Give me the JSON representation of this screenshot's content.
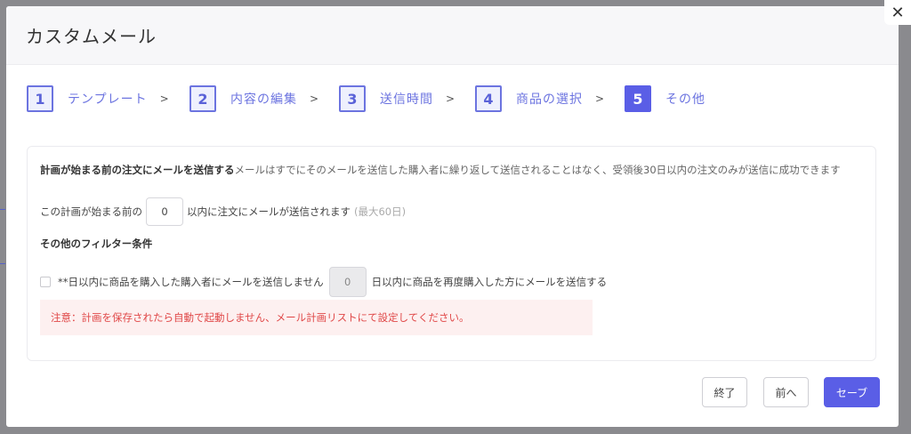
{
  "modal": {
    "title": "カスタムメール",
    "close_symbol": "✕"
  },
  "steps": [
    {
      "num": "1",
      "label": "テンプレート",
      "sep": ">",
      "active": false
    },
    {
      "num": "2",
      "label": "内容の編集",
      "sep": ">",
      "active": false
    },
    {
      "num": "3",
      "label": "送信時間",
      "sep": ">",
      "active": false
    },
    {
      "num": "4",
      "label": "商品の選択",
      "sep": ">",
      "active": false
    },
    {
      "num": "5",
      "label": "その他",
      "sep": "",
      "active": true
    }
  ],
  "panel": {
    "intro_bold": "計画が始まる前の注文にメールを送信する",
    "intro_text": "メールはすでにそのメールを送信した購入者に繰り返して送信されることはなく、受領後30日以内の注文のみが送信に成功できます",
    "row1_prefix": "この計画が始まる前の",
    "row1_value": "0",
    "row1_suffix": "以内に注文にメールが送信されます",
    "row1_hint": "(最大60日)",
    "filter_title": "その他のフィルター条件",
    "row2_prefix": "**日以内に商品を購入した購入者にメールを送信しません",
    "row2_value": "0",
    "row2_suffix": "日以内に商品を再度購入した方にメールを送信する",
    "row2_checked": false,
    "alert": "注意：計画を保存されたら自動で起動しません、メール計画リストにて設定してください。"
  },
  "footer": {
    "end_label": "終了",
    "prev_label": "前へ",
    "save_label": "セーブ"
  },
  "colors": {
    "accent": "#5a5ee6",
    "alert_bg": "#fdf0f0",
    "alert_text": "#e04848"
  }
}
